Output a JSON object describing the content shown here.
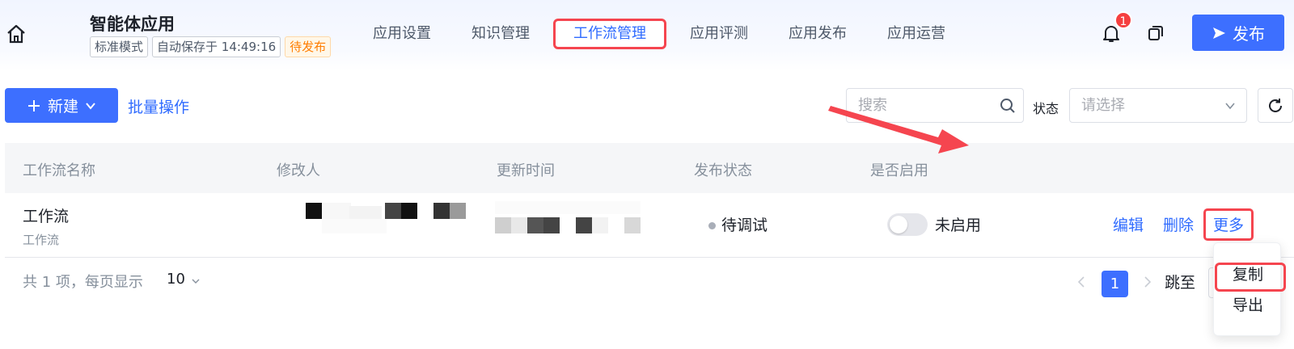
{
  "header": {
    "app_title": "智能体应用",
    "tags": {
      "mode": "标准模式",
      "autosave": "自动保存于 14:49:16",
      "status": "待发布"
    },
    "tabs": [
      {
        "label": "应用设置",
        "active": false
      },
      {
        "label": "知识管理",
        "active": false
      },
      {
        "label": "工作流管理",
        "active": true
      },
      {
        "label": "应用评测",
        "active": false
      },
      {
        "label": "应用发布",
        "active": false
      },
      {
        "label": "应用运营",
        "active": false
      }
    ],
    "notification_count": "1",
    "publish_label": "发布"
  },
  "toolbar": {
    "new_label": "新建",
    "batch_label": "批量操作",
    "search_placeholder": "搜索",
    "status_label": "状态",
    "status_placeholder": "请选择"
  },
  "table": {
    "headers": [
      "工作流名称",
      "修改人",
      "更新时间",
      "发布状态",
      "是否启用"
    ],
    "rows": [
      {
        "name": "工作流",
        "description": "工作流",
        "publish_status": "待调试",
        "enabled_text": "未启用",
        "enabled": false,
        "actions": {
          "edit": "编辑",
          "delete": "删除",
          "more": "更多"
        }
      }
    ]
  },
  "pagination": {
    "total_text": "共 1 项，每页显示",
    "page_size": "10",
    "current_page": "1",
    "jump_label": "跳至"
  },
  "more_menu": {
    "items": [
      "复制",
      "导出"
    ]
  },
  "colors": {
    "primary": "#3d6fff",
    "highlight_box": "#f5454f",
    "warning_tag": "#ff7d00",
    "badge": "#f53f3f"
  }
}
